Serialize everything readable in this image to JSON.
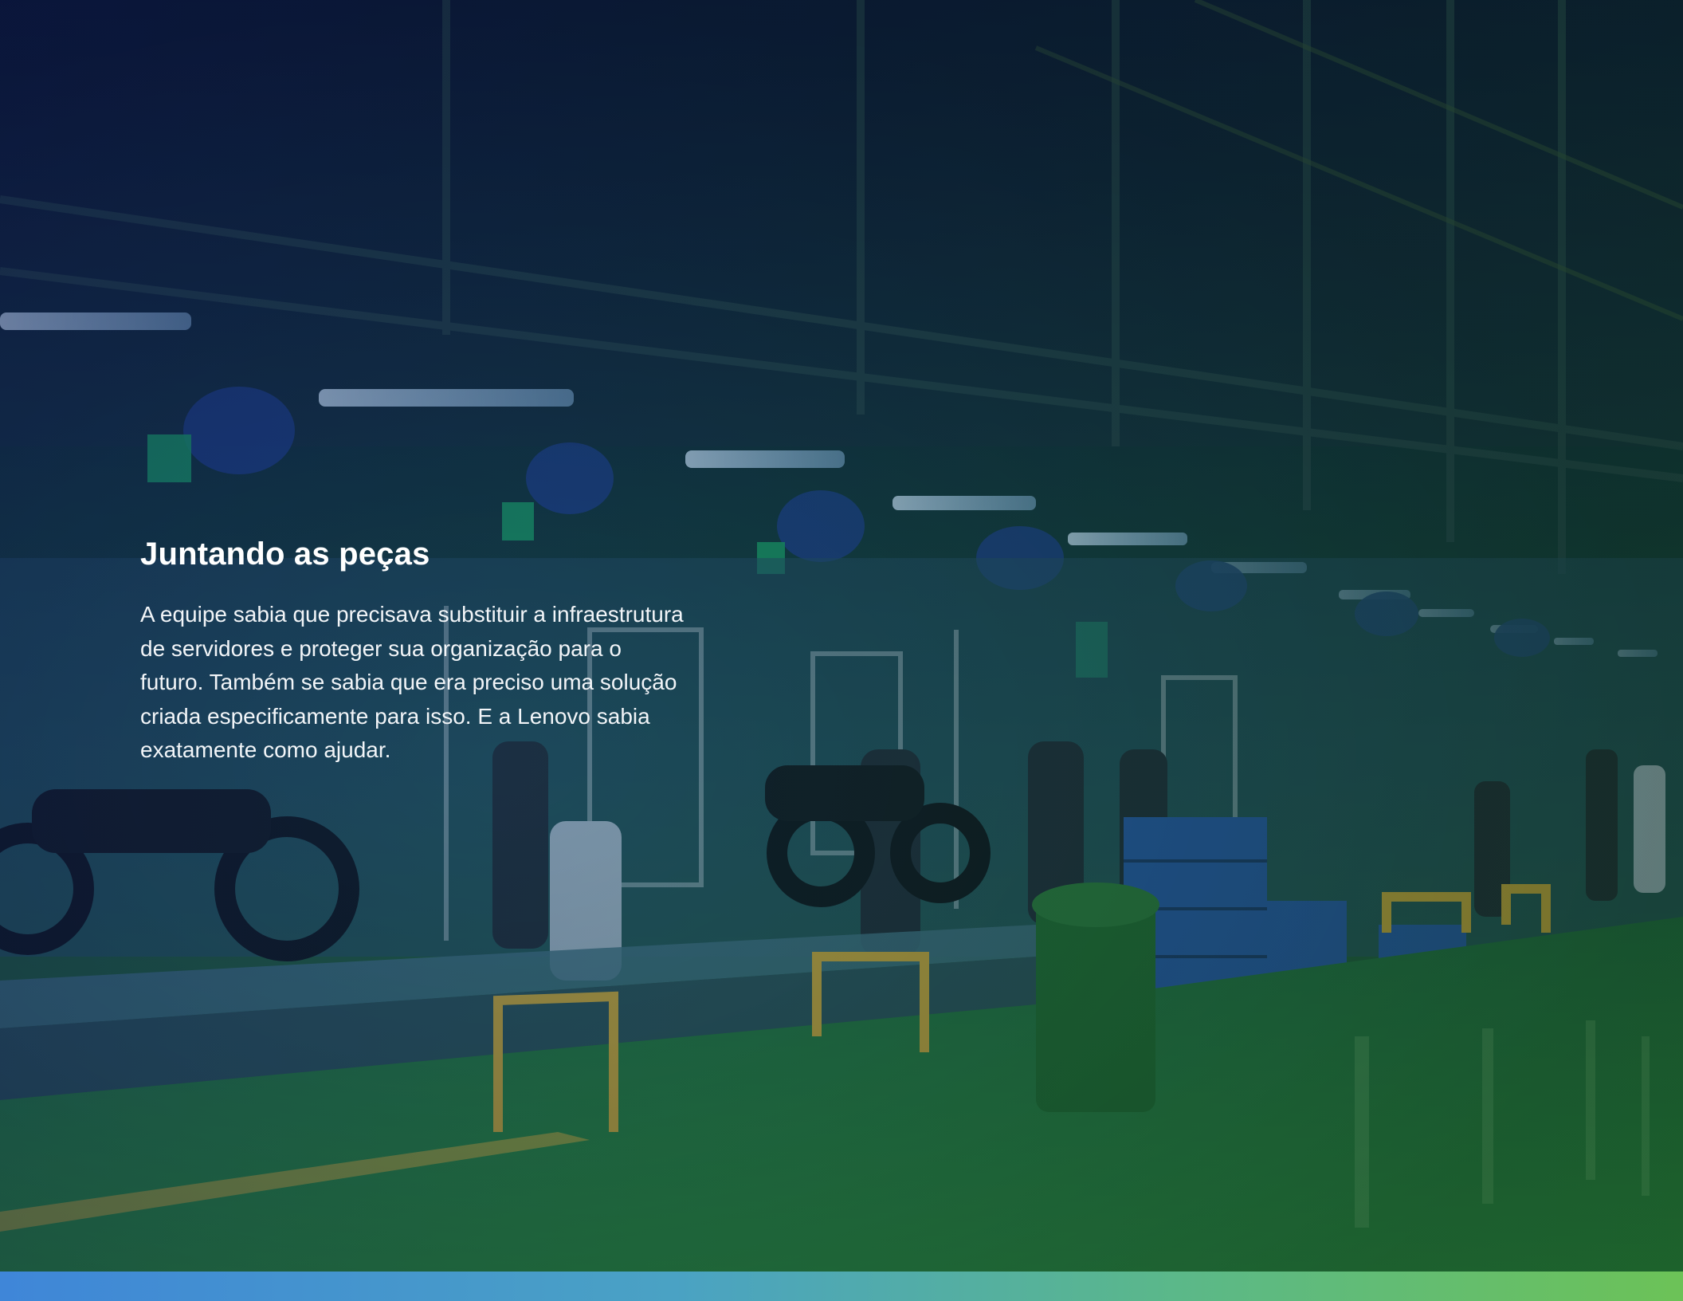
{
  "content": {
    "headline": "Juntando as peças",
    "body_lines": [
      "A equipe sabia que precisava substituir a infraestrutura",
      "de servidores e proteger sua organização para o",
      "futuro. Também se sabia que era preciso uma solução",
      "criada especificamente para isso. E a Lenovo sabia",
      "exatamente como ajudar."
    ]
  },
  "colors": {
    "bar_start": "#3f86d8",
    "bar_end": "#6cc257",
    "text": "#ffffff"
  }
}
